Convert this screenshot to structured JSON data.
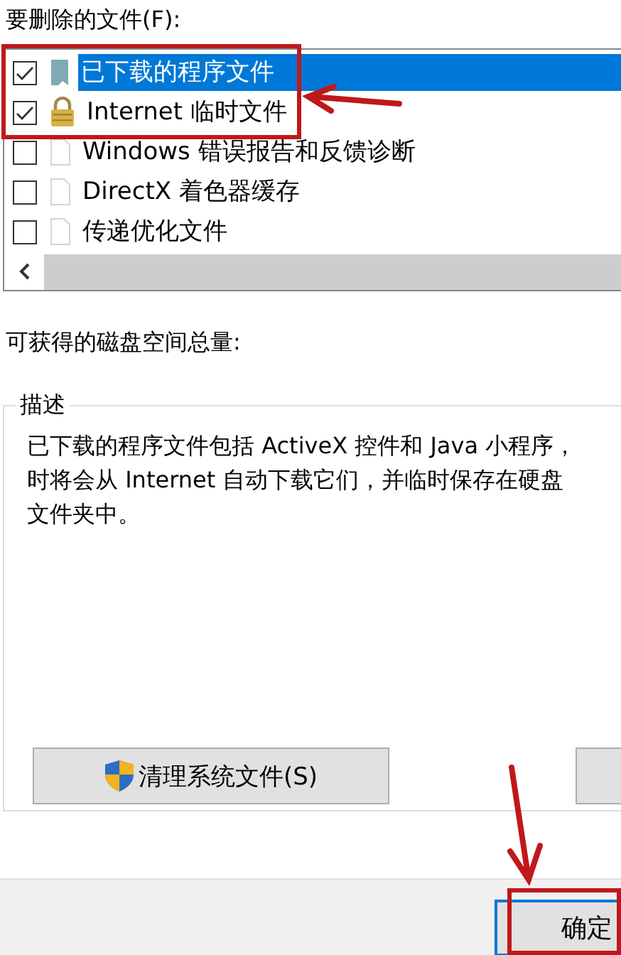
{
  "files_label": "要删除的文件(F):",
  "files": [
    {
      "name": "已下载的程序文件",
      "checked": true,
      "selected": true,
      "kind": "book"
    },
    {
      "name": "Internet 临时文件",
      "checked": true,
      "selected": false,
      "kind": "lock"
    },
    {
      "name": "Windows 错误报告和反馈诊断",
      "checked": false,
      "selected": false,
      "kind": "page"
    },
    {
      "name": "DirectX 着色器缓存",
      "checked": false,
      "selected": false,
      "kind": "page"
    },
    {
      "name": "传递优化文件",
      "checked": false,
      "selected": false,
      "kind": "page"
    }
  ],
  "space_label": "可获得的磁盘空间总量:",
  "description": {
    "title": "描述",
    "lines": [
      "已下载的程序文件包括 ActiveX 控件和 Java 小程序，",
      "时将会从 Internet 自动下载它们，并临时保存在硬盘",
      "文件夹中。"
    ]
  },
  "clean_button": "清理系统文件(S)",
  "ok_button": "确定"
}
